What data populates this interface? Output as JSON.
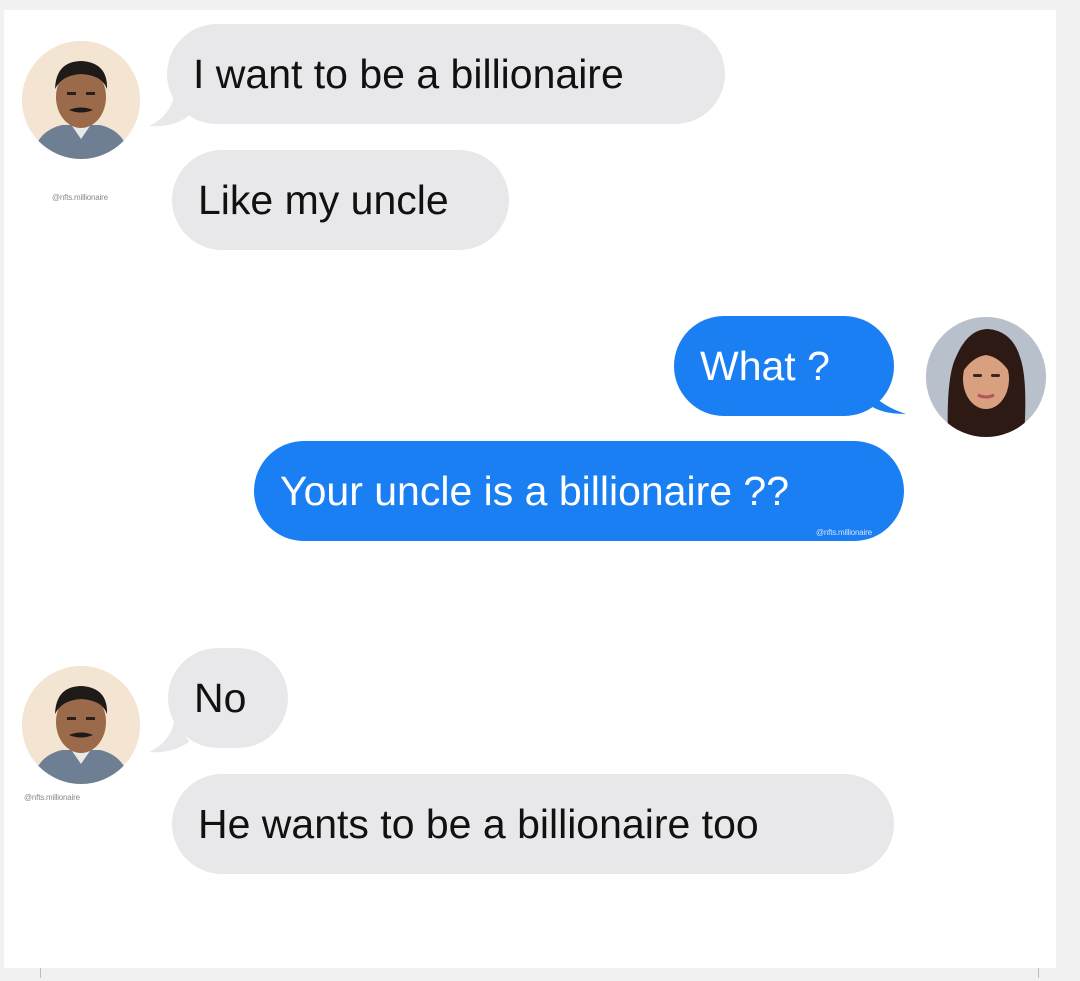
{
  "messages": [
    {
      "from": "uncle_nephew",
      "text": "I want to be a billionaire"
    },
    {
      "from": "uncle_nephew",
      "text": "Like my uncle"
    },
    {
      "from": "woman",
      "text": "What ?"
    },
    {
      "from": "woman",
      "text": "Your uncle is a billionaire ??"
    },
    {
      "from": "uncle_nephew",
      "text": "No"
    },
    {
      "from": "uncle_nephew",
      "text": "He wants to be a billionaire too"
    }
  ],
  "watermarks": {
    "top_left": "@nfts.millionaire",
    "middle": "@nfts.millionaire",
    "bottom_left": "@nfts.millionaire"
  },
  "colors": {
    "received_bubble": "#e8e8ea",
    "sent_bubble": "#1a7ff2",
    "background": "#ffffff"
  }
}
